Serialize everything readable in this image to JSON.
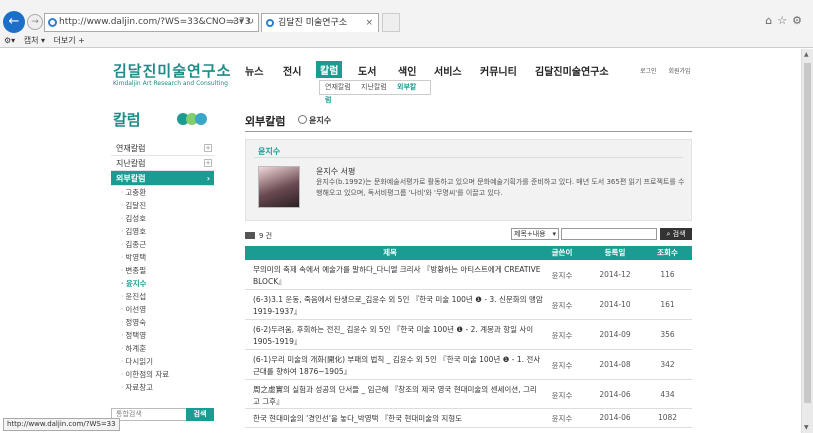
{
  "browser": {
    "url": "http://www.daljin.com/?WS=33&CNO=373",
    "tab_title": "김달진 미술연구소",
    "commands": [
      "캡처 ▾",
      "더보기 +"
    ],
    "status_url": "http://www.daljin.com/?WS=33"
  },
  "header": {
    "logo_kr": "김달진미술연구소",
    "logo_en": "Kimdaljin Art Research and Consulting",
    "nav": [
      "뉴스",
      "전시",
      "칼럼",
      "도서",
      "색인",
      "서비스",
      "커뮤니티",
      "김달진미술연구소"
    ],
    "sub_nav": [
      "연재칼럼",
      "지난칼럼",
      "외부칼럼"
    ],
    "login": "로그인",
    "join": "회원가입"
  },
  "sidebar": {
    "title": "칼럼",
    "menus": [
      "연재칼럼",
      "지난칼럼",
      "외부칼럼"
    ],
    "authors": [
      "고충환",
      "김달진",
      "김성호",
      "김영호",
      "김종근",
      "박영택",
      "변종필",
      "윤지수",
      "윤진섭",
      "이선영",
      "정영숙",
      "정택영",
      "하계훈",
      "다시읽기",
      "이한점의 자료",
      "자료창고"
    ],
    "search_placeholder": "통합검색",
    "search_button": "검색",
    "dot_colors": [
      "#1a9c93",
      "#7fcf6a",
      "#3aa7c9"
    ]
  },
  "main": {
    "title": "외부칼럼",
    "subtitle": "윤지수",
    "profile": {
      "heading": "윤지수",
      "name": "윤지수 서평",
      "desc": "윤지수(b.1992)는 문화예술서평가로 활동하고 있으며 문화예술기획가를 준비하고 있다. 매년 도서 365편 읽기 프로젝트를 수행해오고 있으며, 독서비평그룹 '나비'와 '무명씨'를 이끌고 있다."
    },
    "count": "9 건",
    "select_value": "제목+내용",
    "search_button": "검색",
    "columns": [
      "제목",
      "글쓴이",
      "등록일",
      "조회수"
    ],
    "rows": [
      {
        "title": "무의미의 축제 속에서 예술가를 말하다_다니엘 크리사 『방황하는 아티스트에게 CREATIVE BLOCK』",
        "author": "윤지수",
        "date": "2014-12",
        "views": "116"
      },
      {
        "title": "(6-3)3.1 운동, 죽음에서 탄생으로_김윤수 외 5인 『한국 미술 100년 ❶ - 3. 신문화의 맹암 1919-1937』",
        "author": "윤지수",
        "date": "2014-10",
        "views": "161"
      },
      {
        "title": "(6-2)두려움, 후회하는 전진_ 김윤수 외 5인 『한국 미술 100년 ❶ - 2. 계몽과 항일 사이 1905-1919』",
        "author": "윤지수",
        "date": "2014-09",
        "views": "356"
      },
      {
        "title": "(6-1)우리 미술의 개화(開化) 부패의 법칙 _ 김윤수 외 5인 『한국 미술 100년 ❶ - 1. 전사 근대를 향하여 1876~1905』",
        "author": "윤지수",
        "date": "2014-08",
        "views": "342"
      },
      {
        "title": "周之虛實의 실험과 성공의 단서들 _ 임근혜 『창조의 제국 영국 현대미술의 센세이션, 그리고 그후』",
        "author": "윤지수",
        "date": "2014-06",
        "views": "434"
      },
      {
        "title": "한국 현대미술의 '경인선'을 놓다_박영택 『한국 현대미술의 지형도",
        "author": "윤지수",
        "date": "2014-06",
        "views": "1082"
      }
    ]
  }
}
